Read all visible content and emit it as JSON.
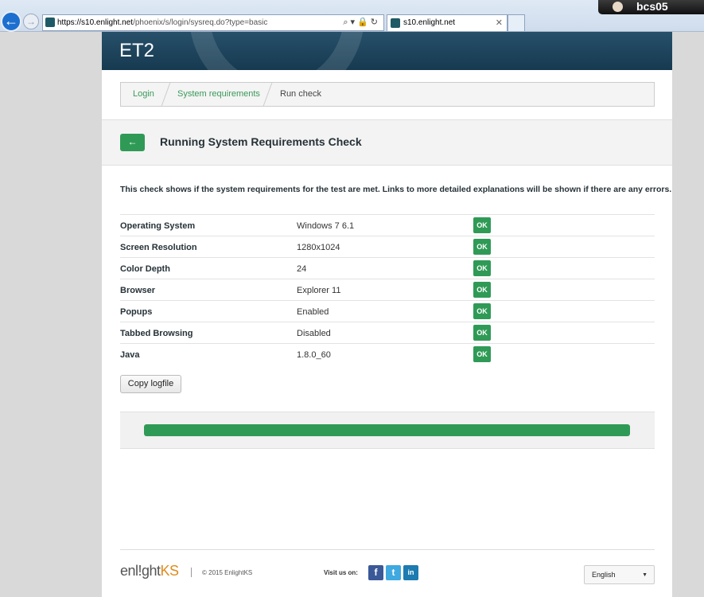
{
  "browser": {
    "url_host": "https://s10.enlight.net",
    "url_path": "/phoenix/s/login/sysreq.do?type=basic",
    "tab_title": "s10.enlight.net",
    "user": "bcs05"
  },
  "banner": {
    "logo": "ET2"
  },
  "breadcrumb": [
    {
      "label": "Login"
    },
    {
      "label": "System requirements"
    },
    {
      "label": "Run check"
    }
  ],
  "header": {
    "back_icon": "←",
    "title": "Running System Requirements Check"
  },
  "intro": "This check shows if the system requirements for the test are met. Links to more detailed explanations will be shown if there are any errors.",
  "requirements": [
    {
      "label": "Operating System",
      "value": "Windows 7 6.1",
      "status": "OK"
    },
    {
      "label": "Screen Resolution",
      "value": "1280x1024",
      "status": "OK"
    },
    {
      "label": "Color Depth",
      "value": "24",
      "status": "OK"
    },
    {
      "label": "Browser",
      "value": "Explorer 11",
      "status": "OK"
    },
    {
      "label": "Popups",
      "value": "Enabled",
      "status": "OK"
    },
    {
      "label": "Tabbed Browsing",
      "value": "Disabled",
      "status": "OK"
    },
    {
      "label": "Java",
      "value": "1.8.0_60",
      "status": "OK"
    }
  ],
  "copy_button": "Copy logfile",
  "progress": {
    "percent": 100,
    "color": "#2f9a56"
  },
  "footer": {
    "logo_main": "enl!ght",
    "logo_accent": "KS",
    "copyright": "© 2015 EnlightKS",
    "visit_label": "Visit us on:",
    "language": "English"
  },
  "colors": {
    "accent": "#2f9a56",
    "banner": "#1f4760"
  }
}
